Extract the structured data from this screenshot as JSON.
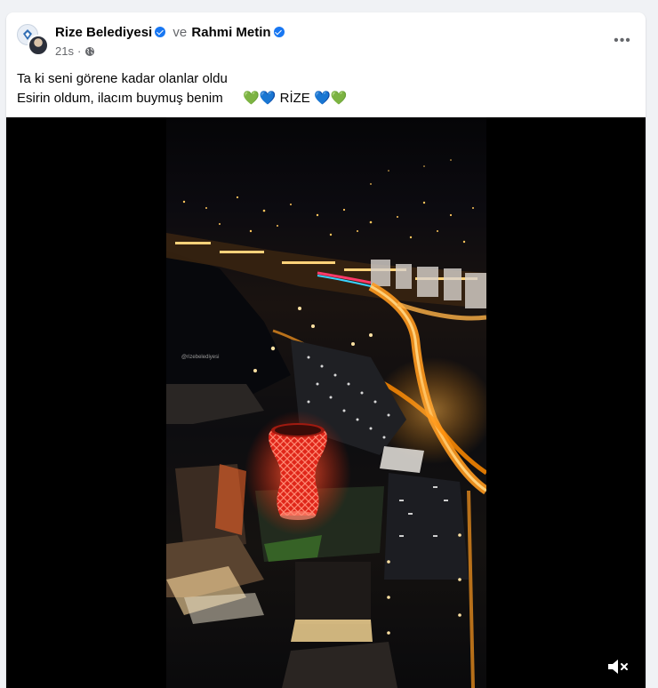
{
  "post": {
    "author_1": "Rize Belediyesi",
    "conjunction": "ve",
    "author_2": "Rahmi Metin",
    "time": "21s",
    "separator": "·",
    "more_label": "•••",
    "line_1": "Ta ki seni görene kadar olanlar oldu",
    "line_2": "Esirin oldum, ilacım buymuş benim",
    "hashtag": "RİZE",
    "heart_green": "💚",
    "heart_blue": "💙"
  },
  "video": {
    "watermark": "@rizebelediyesi"
  },
  "icons": {
    "verified": "verified-badge-icon",
    "globe": "globe-icon",
    "more": "more-options-icon",
    "mute": "speaker-muted-icon"
  },
  "colors": {
    "verified_blue": "#1877f2",
    "tower_red": "#e0261a",
    "street_orange": "#ff9a1f"
  }
}
